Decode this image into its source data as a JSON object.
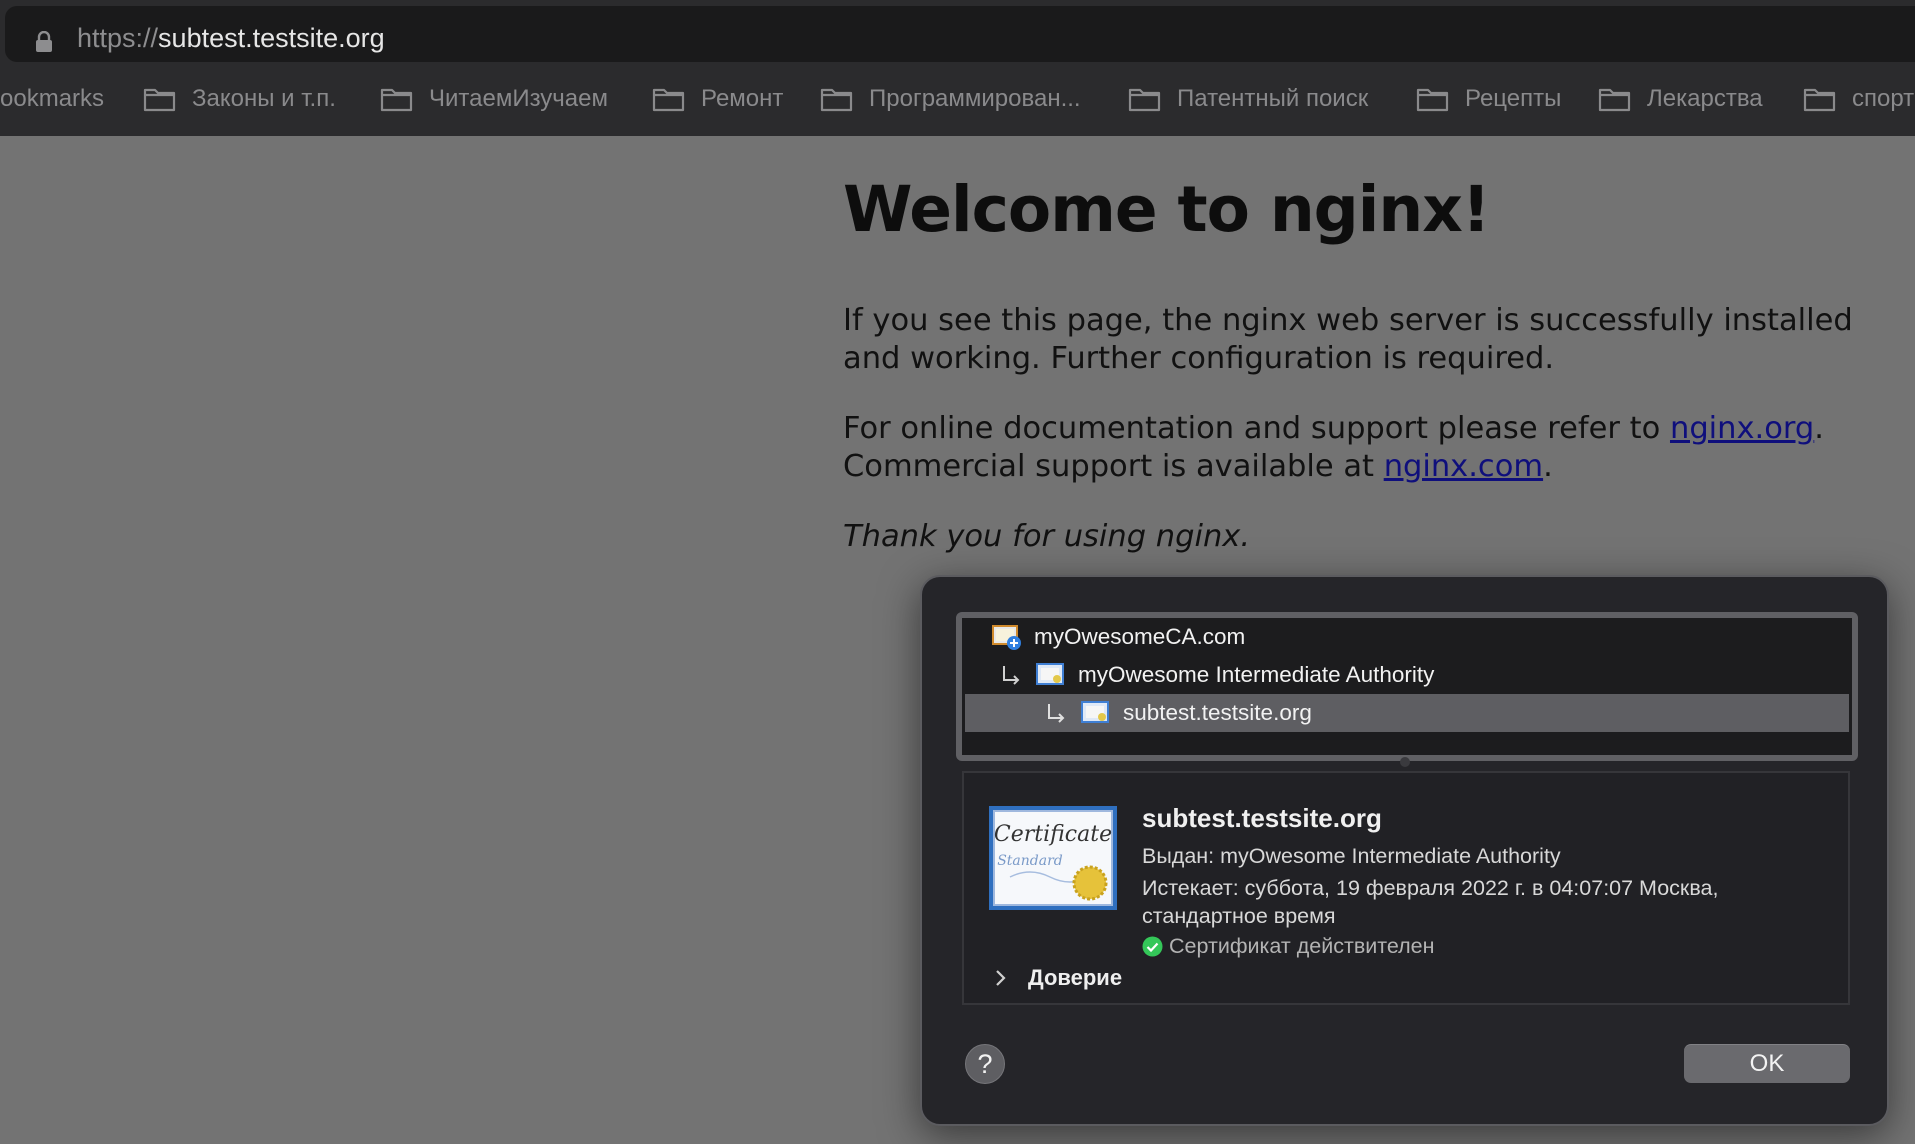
{
  "browser": {
    "url_scheme": "https://",
    "url_host": "subtest.testsite.org",
    "bookmarks": [
      {
        "label": "ookmarks",
        "has_folder_icon": false
      },
      {
        "label": "Законы и т.п.",
        "has_folder_icon": true
      },
      {
        "label": "ЧитаемИзучаем",
        "has_folder_icon": true
      },
      {
        "label": "Ремонт",
        "has_folder_icon": true
      },
      {
        "label": "Программирован...",
        "has_folder_icon": true
      },
      {
        "label": "Патентный поиск",
        "has_folder_icon": true
      },
      {
        "label": "Рецепты",
        "has_folder_icon": true
      },
      {
        "label": "Лекарства",
        "has_folder_icon": true
      },
      {
        "label": "спорт",
        "has_folder_icon": true
      }
    ]
  },
  "page": {
    "title": "Welcome to nginx!",
    "p1": "If you see this page, the nginx web server is successfully installed and working. Further configuration is required.",
    "p2_prefix": "For online documentation and support please refer to ",
    "link_org": "nginx.org",
    "p2_middle": ".",
    "p2_line2_prefix": "Commercial support is available at ",
    "link_com": "nginx.com",
    "p2_suffix": ".",
    "p3": "Thank you for using nginx."
  },
  "dialog": {
    "chain": [
      {
        "label": "myOwesomeCA.com",
        "icon": "root-certificate-icon",
        "selected": false
      },
      {
        "label": "myOwesome Intermediate Authority",
        "icon": "certificate-icon",
        "selected": false
      },
      {
        "label": "subtest.testsite.org",
        "icon": "certificate-icon",
        "selected": true
      }
    ],
    "detail": {
      "name": "subtest.testsite.org",
      "issued_by": "Выдан: myOwesome Intermediate Authority",
      "expires": "Истекает: суббота, 19 февраля 2022 г. в 04:07:07 Москва, стандартное время",
      "status": "Сертификат действителен",
      "trust_label": "Доверие",
      "cert_image_text_1": "Certificate",
      "cert_image_text_2": "Standard"
    },
    "help_label": "?",
    "ok_label": "OK"
  },
  "colors": {
    "page_background": "#737373",
    "link": "#0f0f7c",
    "valid_check": "#34c759"
  }
}
